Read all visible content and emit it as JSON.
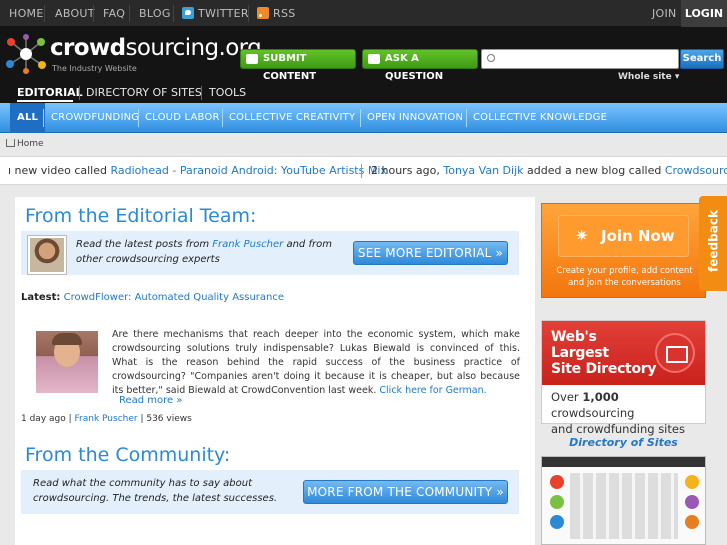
{
  "topnav": {
    "home": "HOME",
    "about": "ABOUT",
    "faq": "FAQ",
    "blog": "BLOG",
    "twitter": "TWITTER",
    "rss": "RSS",
    "join": "JOIN",
    "login": "LOGIN"
  },
  "header": {
    "logo_bold": "crowd",
    "logo_rest": "sourcing.org",
    "tagline": "The Industry Website",
    "submit": "SUBMIT CONTENT",
    "ask": "ASK A QUESTION",
    "search_placeholder": "",
    "search_btn": "Search",
    "scope": "Whole site ▾",
    "nav": [
      "EDITORIAL",
      "DIRECTORY OF SITES",
      "TOOLS"
    ]
  },
  "categories": [
    "ALL",
    "CROWDFUNDING",
    "CLOUD LABOR",
    "COLLECTIVE CREATIVITY",
    "OPEN INNOVATION",
    "COLLECTIVE KNOWLEDGE"
  ],
  "breadcrumb": "Home",
  "ticker": {
    "a_pre": "ı new video called ",
    "a_link": "Radiohead - Paranoid Android: YouTube Artists Mix",
    "b_time": "2 hours ago, ",
    "b_user": "Tonya Van Dijk",
    "b_mid": " added a new blog called ",
    "b_link": "Crowdsourcing: V"
  },
  "editorial": {
    "title": "From the Editorial Team:",
    "callout_pre": "Read the latest posts from ",
    "callout_name": "Frank Puscher",
    "callout_post": " and from",
    "callout_line2": "other crowdsourcing experts",
    "button": "SEE MORE EDITORIAL »",
    "latest_label": "Latest:",
    "latest_link": "CrowdFlower: Automated Quality Assurance",
    "article_text": "Are there mechanisms that reach deeper into the economic system, which make crowdsourcing solutions truly indispensable? Lukas Biewald is convinced of this. What is the reason behind the rapid success of the business practice of crowdsourcing? \"Companies aren't doing it because it is cheaper, but also because its better,\" said Biewald at CrowdConvention last week. ",
    "article_link": "Click here for German.",
    "read_more": "Read more »",
    "meta_time": "1 day ago",
    "meta_author": "Frank Puscher",
    "meta_views": "536 views"
  },
  "community": {
    "title": "From the Community:",
    "line1": "Read what the community has to say about",
    "line2": "crowdsourcing. The trends, the latest successes.",
    "button": "MORE FROM THE COMMUNITY »"
  },
  "sidebar": {
    "join": "Join Now",
    "join_text": "Create your profile, add content and join the conversations",
    "feedback": "feedback",
    "dir_line1": "Web's",
    "dir_line2": "Largest",
    "dir_line3": "Site Directory",
    "dir_over_a": "Over ",
    "dir_over_b": "1,000",
    "dir_over_c": " crowdsourcing",
    "dir_over_line2": "and crowdfunding sites",
    "dir_link": "Directory of Sites"
  },
  "colors": {
    "accent_blue": "#2b8ad6",
    "green": "#4fae1c",
    "orange": "#f3760d",
    "red": "#c9211c"
  }
}
